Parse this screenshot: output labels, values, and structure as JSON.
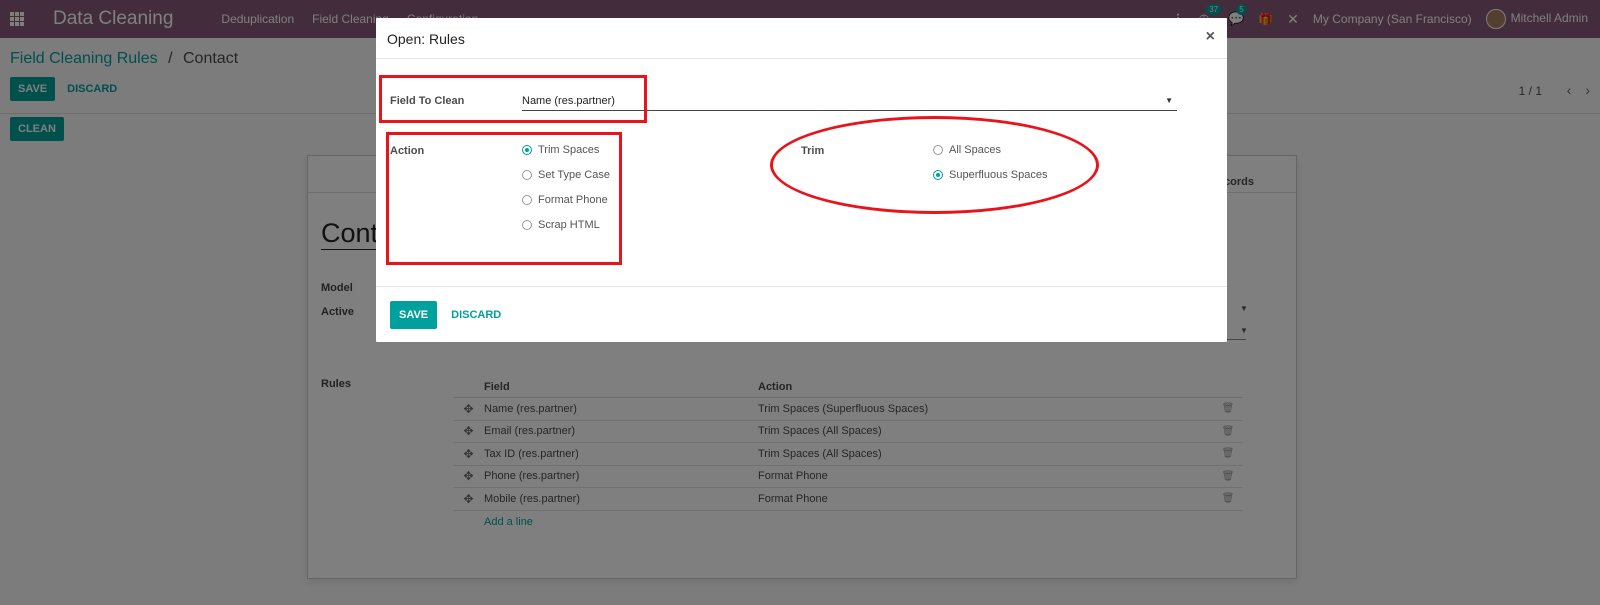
{
  "navbar": {
    "brand": "Data Cleaning",
    "menu": [
      "Deduplication",
      "Field Cleaning",
      "Configuration"
    ],
    "activity_count": "37",
    "messages_count": "5",
    "company": "My Company (San Francisco)",
    "user": "Mitchell Admin"
  },
  "breadcrumb": {
    "parent": "Field Cleaning Rules",
    "separator": "/",
    "current": "Contact"
  },
  "control_panel": {
    "save_label": "SAVE",
    "discard_label": "DISCARD",
    "clean_label": "CLEAN",
    "pager": "1 / 1"
  },
  "sheet": {
    "tab_label": "cords",
    "title": "Contact",
    "model_label": "Model",
    "active_label": "Active",
    "rules_label": "Rules",
    "table": {
      "headers": [
        "Field",
        "Action"
      ],
      "rows": [
        {
          "field": "Name (res.partner)",
          "action": "Trim Spaces (Superfluous Spaces)"
        },
        {
          "field": "Email (res.partner)",
          "action": "Trim Spaces (All Spaces)"
        },
        {
          "field": "Tax ID (res.partner)",
          "action": "Trim Spaces (All Spaces)"
        },
        {
          "field": "Phone (res.partner)",
          "action": "Format Phone"
        },
        {
          "field": "Mobile (res.partner)",
          "action": "Format Phone"
        }
      ],
      "add_line": "Add a line"
    }
  },
  "modal": {
    "title": "Open: Rules",
    "close": "×",
    "field_to_clean_label": "Field To Clean",
    "field_to_clean_value": "Name (res.partner)",
    "action_label": "Action",
    "action_options": [
      {
        "label": "Trim Spaces",
        "checked": true
      },
      {
        "label": "Set Type Case",
        "checked": false
      },
      {
        "label": "Format Phone",
        "checked": false
      },
      {
        "label": "Scrap HTML",
        "checked": false
      }
    ],
    "trim_label": "Trim",
    "trim_options": [
      {
        "label": "All Spaces",
        "checked": false
      },
      {
        "label": "Superfluous Spaces",
        "checked": true
      }
    ],
    "save_label": "SAVE",
    "discard_label": "DISCARD"
  },
  "colors": {
    "navbar": "#875a7b",
    "primary": "#00a09d",
    "annotation": "#e8141b"
  }
}
